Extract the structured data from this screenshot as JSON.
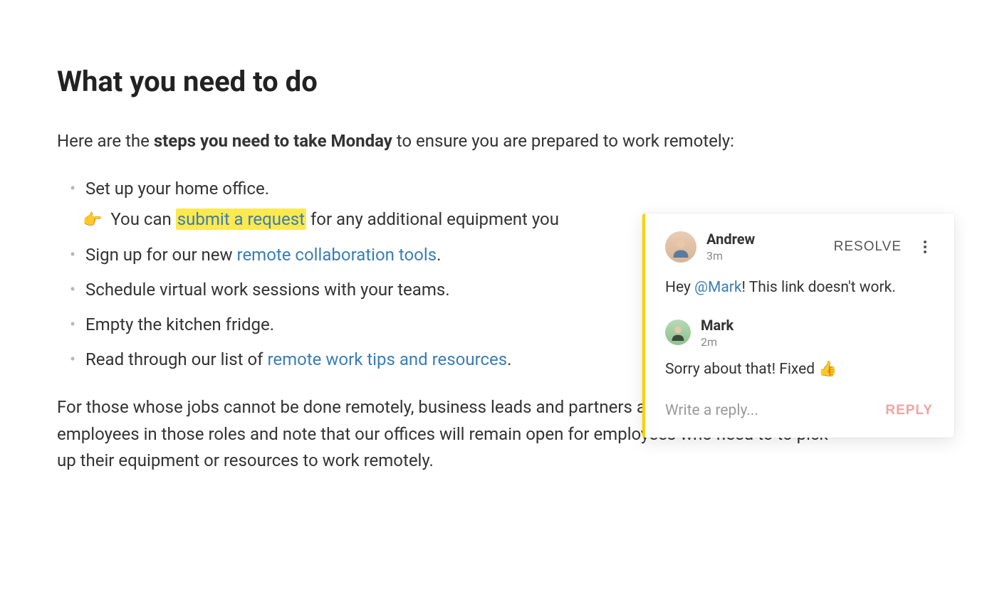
{
  "heading": "What you need to do",
  "intro": {
    "prefix": "Here are the ",
    "bold": "steps you need to take Monday",
    "suffix": " to ensure you are prepared to work remotely:"
  },
  "steps": [
    {
      "text": "Set up your home office.",
      "sub": {
        "emoji": "👉",
        "before": " You can ",
        "link": "submit a request",
        "after": " for any additional equipment you"
      }
    },
    {
      "before": "Sign up for our new ",
      "link": "remote collaboration tools",
      "after": "."
    },
    {
      "text": "Schedule virtual work sessions with your teams."
    },
    {
      "text": "Empty the kitchen fridge."
    },
    {
      "before": "Read through our list of ",
      "link": "remote work tips and resources",
      "after": "."
    }
  ],
  "paragraph": "For those whose jobs cannot be done remotely, business leads and partners and managers to support employees in those roles and note that our offices will remain open for employees who need to to pick up their equipment or resources to work remotely.",
  "comments": {
    "resolve_label": "RESOLVE",
    "reply_label": "REPLY",
    "reply_placeholder": "Write a reply...",
    "thread": [
      {
        "author": "Andrew",
        "time": "3m",
        "body_prefix": "Hey ",
        "mention": "@Mark",
        "body_suffix": "! This link doesn't work."
      },
      {
        "author": "Mark",
        "time": "2m",
        "body": "Sorry about that! Fixed 👍"
      }
    ]
  }
}
